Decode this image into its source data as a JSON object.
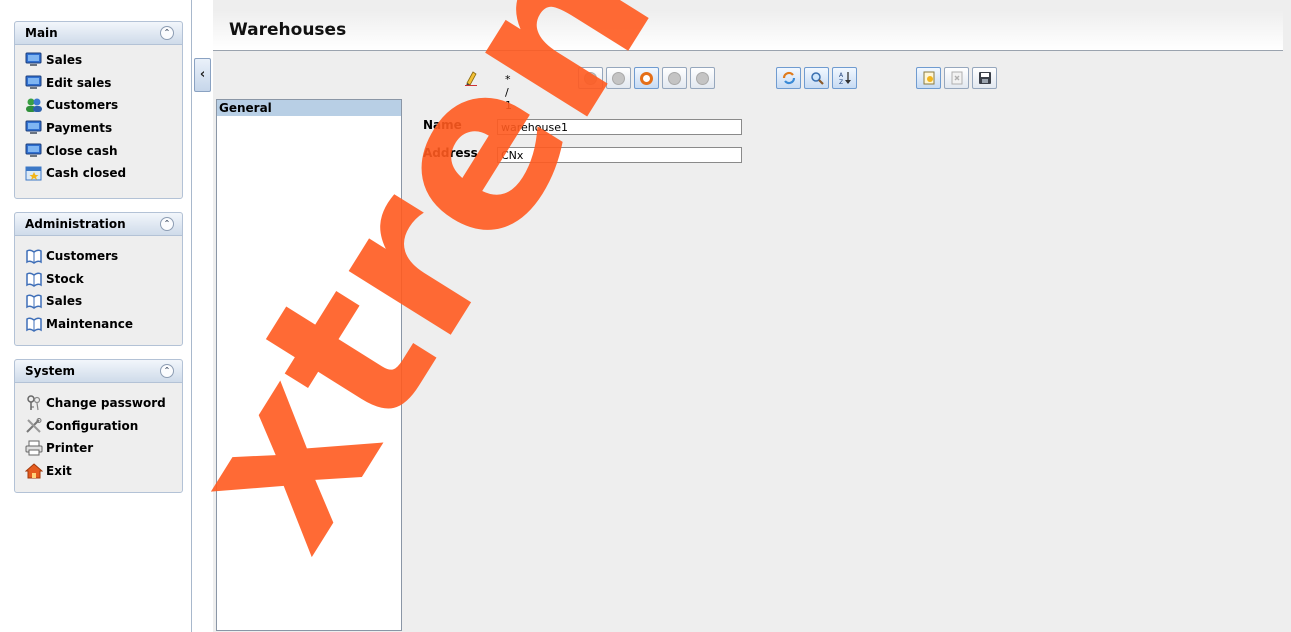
{
  "nav": {
    "panels": [
      {
        "title": "Main",
        "items": [
          {
            "label": "Sales",
            "icon": "monitor-icon"
          },
          {
            "label": "Edit sales",
            "icon": "monitor-icon"
          },
          {
            "label": "Customers",
            "icon": "users-icon"
          },
          {
            "label": "Payments",
            "icon": "monitor-icon"
          },
          {
            "label": "Close cash",
            "icon": "monitor-icon"
          },
          {
            "label": "Cash closed",
            "icon": "calendar-icon"
          }
        ]
      },
      {
        "title": "Administration",
        "items": [
          {
            "label": "Customers",
            "icon": "book-icon"
          },
          {
            "label": "Stock",
            "icon": "book-icon"
          },
          {
            "label": "Sales",
            "icon": "book-icon"
          },
          {
            "label": "Maintenance",
            "icon": "book-icon"
          }
        ]
      },
      {
        "title": "System",
        "items": [
          {
            "label": "Change password",
            "icon": "keys-icon"
          },
          {
            "label": "Configuration",
            "icon": "tools-icon"
          },
          {
            "label": "Printer",
            "icon": "printer-icon"
          },
          {
            "label": "Exit",
            "icon": "home-icon"
          }
        ]
      }
    ],
    "collapse_glyph": "‹"
  },
  "main": {
    "title": "Warehouses",
    "record_counter": "* / 1",
    "tree_item": "General",
    "form": {
      "name_label": "Name",
      "name_value": "warehouse1",
      "address_label": "Address",
      "address_value": "CNx"
    }
  },
  "watermark": {
    "text": "xtreme",
    "color": "#ff5a1f"
  }
}
